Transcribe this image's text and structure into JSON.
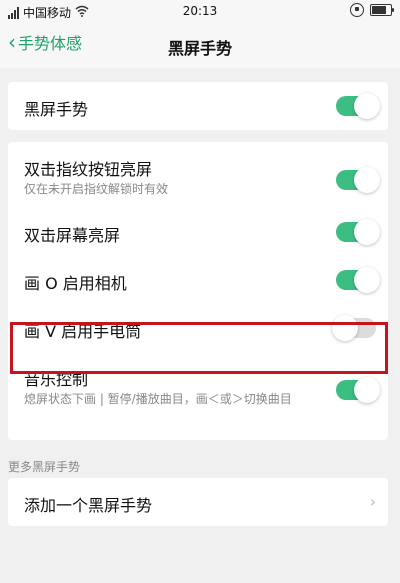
{
  "status": {
    "carrier": "中国移动",
    "time": "20:13",
    "battery_level": 0.85
  },
  "nav": {
    "back_label": "手势体感",
    "title": "黑屏手势"
  },
  "card1": {
    "row1_label": "黑屏手势",
    "row1_on": true
  },
  "card2": {
    "row1_label": "双击指纹按钮亮屏",
    "row1_sub": "仅在未开启指纹解锁时有效",
    "row1_on": true,
    "row2_label": "双击屏幕亮屏",
    "row2_on": true,
    "row3_label": "画 O 启用相机",
    "row3_on": true,
    "row4_label": "画 V 启用手电筒",
    "row4_on": false,
    "row5_label": "音乐控制",
    "row5_sub": "熄屏状态下画 | 暂停/播放曲目，画＜或＞切换曲目",
    "row5_on": true
  },
  "section_label": "更多黑屏手势",
  "card3": {
    "row1_label": "添加一个黑屏手势"
  },
  "colors": {
    "accent": "#3cbe83",
    "back": "#20a06b",
    "highlight": "#c2151d"
  }
}
